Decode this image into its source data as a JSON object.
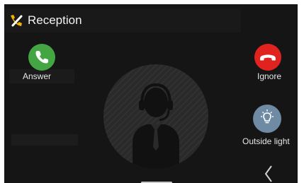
{
  "header": {
    "title": "Reception",
    "icon": "handset-icon"
  },
  "actions": {
    "answer_label": "Answer",
    "ignore_label": "Ignore",
    "outside_light_label": "Outside light"
  },
  "icons": {
    "answer": "phone-icon",
    "ignore": "hang-up-icon",
    "outside_light": "light-bulb-icon",
    "avatar": "receptionist-avatar-icon",
    "back": "chevron-left-icon"
  },
  "colors": {
    "answer": "#43a643",
    "ignore": "#e0231f",
    "outside_light": "#6f8ba4",
    "title_icon": "#f0b400"
  }
}
